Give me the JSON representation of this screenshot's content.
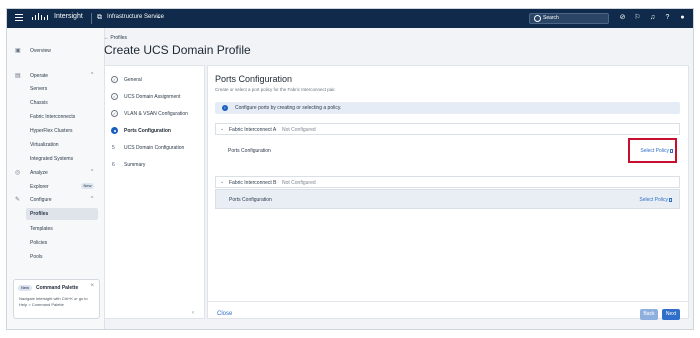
{
  "topbar": {
    "app_name": "Intersight",
    "service": "Infrastructure Service",
    "search_label": "Search"
  },
  "nav": {
    "overview": "Overview",
    "operate": "Operate",
    "operate_items": [
      "Servers",
      "Chassis",
      "Fabric Interconnects",
      "HyperFlex Clusters",
      "Virtualization",
      "Integrated Systems"
    ],
    "analyze": "Analyze",
    "explorer": "Explorer",
    "new_badge": "New",
    "configure": "Configure",
    "configure_items": [
      "Profiles",
      "Templates",
      "Policies",
      "Pools"
    ]
  },
  "command_palette": {
    "badge": "New",
    "title": "Command Palette",
    "text": "Navigate Intersight with Ctrl+K or go to Help > Command Palette"
  },
  "header": {
    "breadcrumb": "← Profiles",
    "title": "Create UCS Domain Profile"
  },
  "steps": [
    {
      "label": "General",
      "state": "done"
    },
    {
      "label": "UCS Domain Assignment",
      "state": "done"
    },
    {
      "label": "VLAN & VSAN Configuration",
      "state": "done"
    },
    {
      "label": "Ports Configuration",
      "state": "active"
    },
    {
      "label": "UCS Domain Configuration",
      "state": "pending",
      "num": "5"
    },
    {
      "label": "Summary",
      "state": "pending",
      "num": "6"
    }
  ],
  "main": {
    "title": "Ports Configuration",
    "subtitle": "Create or select a port policy for the Fabric Interconnect pair.",
    "info": "Configure ports by creating or selecting a policy.",
    "fi_a": {
      "name": "Fabric Interconnect A",
      "state": "Not Configured",
      "row_label": "Ports Configuration",
      "action": "Select Policy"
    },
    "fi_b": {
      "name": "Fabric Interconnect B",
      "state": "Not Configured",
      "row_label": "Ports Configuration",
      "action": "Select Policy"
    },
    "close": "Close",
    "back": "Back",
    "next": "Next"
  },
  "colors": {
    "topbar": "#0f2a4a",
    "accent": "#2f6fc9",
    "highlight": "#c8102e"
  }
}
